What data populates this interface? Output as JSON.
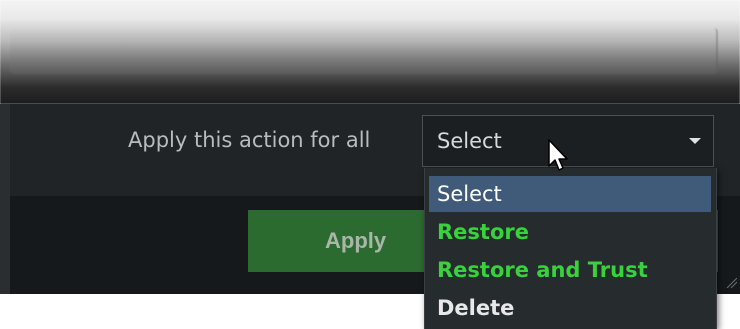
{
  "action_row": {
    "label": "Apply this action for all",
    "select_value": "Select"
  },
  "apply_button": {
    "label": "Apply"
  },
  "dropdown": {
    "options": [
      {
        "label": "Select",
        "state": "highlighted"
      },
      {
        "label": "Restore",
        "color": "#39d13c"
      },
      {
        "label": "Restore and Trust",
        "color": "#39d13c"
      },
      {
        "label": "Delete",
        "color": "#e6e8ea"
      }
    ]
  },
  "colors": {
    "panel": "#202427",
    "apply_button": "#2b6b2f",
    "highlight": "#3f5b79",
    "green_text": "#39d13c"
  },
  "icons": {
    "caret": "chevron-down-icon",
    "cursor": "mouse-pointer-icon",
    "grip": "resize-grip-icon"
  }
}
